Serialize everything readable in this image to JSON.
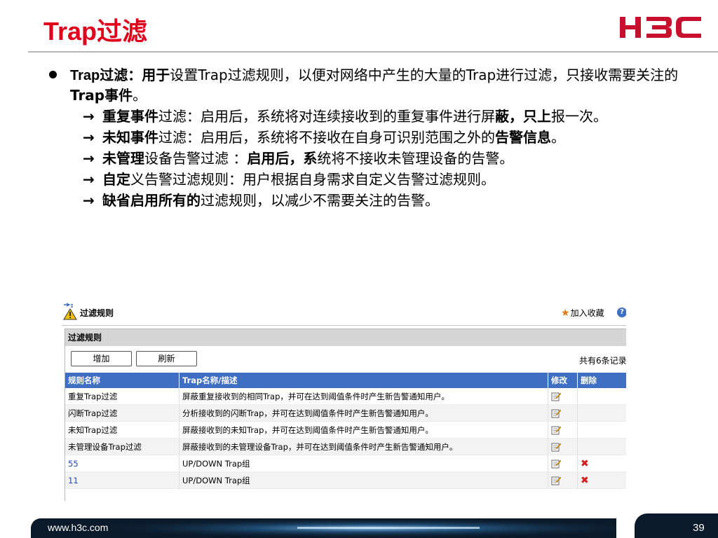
{
  "slide": {
    "title": "Trap过滤",
    "logo_text": "H3C",
    "footer_url": "www.h3c.com",
    "page_number": "39"
  },
  "bullet": {
    "lead_bold_a": "Trap过滤",
    "lead_bold_b": "：用于",
    "text1": "设置Trap过滤规则，以便对网络中产生的大量的Trap进行过滤，只接收需要关注的",
    "text1_bold": "Trap事件",
    "text1_end": "。"
  },
  "subs": [
    {
      "arrow": "→",
      "bold": "重复事件",
      "text": "过滤：启用后，系统将对连续接收到的重复事件进行屏",
      "line2_bold": "蔽，只上",
      "line2": "报一次。"
    },
    {
      "arrow": "→",
      "bold": "未知事件",
      "text": "过滤：启用后，系统将不接收在自身可识别范围之外的",
      "line2_bold": "告警信息",
      "line2": "。"
    },
    {
      "arrow": "→",
      "bold": "未管理",
      "text": "设备告警过滤 ：",
      "bold2": "启用后，系",
      "text2": "统将不接收未管理设备的告",
      "line2": "警。"
    },
    {
      "arrow": "→",
      "bold": "自定",
      "text": "义告警过滤规则：用户根据自身需求自定义告警过滤规则。"
    },
    {
      "arrow": "→",
      "bold": "缺省启用所有的",
      "text": "过滤规则，以减少不需要关注的告警。"
    }
  ],
  "screen": {
    "page_title": "过滤规则",
    "favorite_label": "加入收藏",
    "help_label": "?",
    "panel_title": "过滤规则",
    "add_button": "增加",
    "refresh_button": "刷新",
    "record_count": "共有6条记录",
    "columns": [
      "规则名称",
      "Trap名称/描述",
      "修改",
      "删除"
    ],
    "rows": [
      {
        "name": "重复Trap过滤",
        "desc": "屏蔽重复接收到的相同Trap，并可在达到阈值条件时产生新告警通知用户。",
        "deletable": false,
        "link": false
      },
      {
        "name": "闪断Trap过滤",
        "desc": "分析接收到的闪断Trap，并可在达到阈值条件时产生新告警通知用户。",
        "deletable": false,
        "link": false
      },
      {
        "name": "未知Trap过滤",
        "desc": "屏蔽接收到的未知Trap，并可在达到阈值条件时产生新告警通知用户。",
        "deletable": false,
        "link": false
      },
      {
        "name": "未管理设备Trap过滤",
        "desc": "屏蔽接收到的未管理设备Trap，并可在达到阈值条件时产生新告警通知用户。",
        "deletable": false,
        "link": false
      },
      {
        "name": "55",
        "desc": "UP/DOWN Trap组",
        "deletable": true,
        "link": true
      },
      {
        "name": "11",
        "desc": "UP/DOWN Trap组",
        "deletable": true,
        "link": true
      }
    ]
  },
  "colors": {
    "title_red": "#e0001b",
    "logo_red": "#c8102e",
    "table_header": "#3f6fc3",
    "link_blue": "#1f49b5",
    "delete_red": "#d22020"
  }
}
